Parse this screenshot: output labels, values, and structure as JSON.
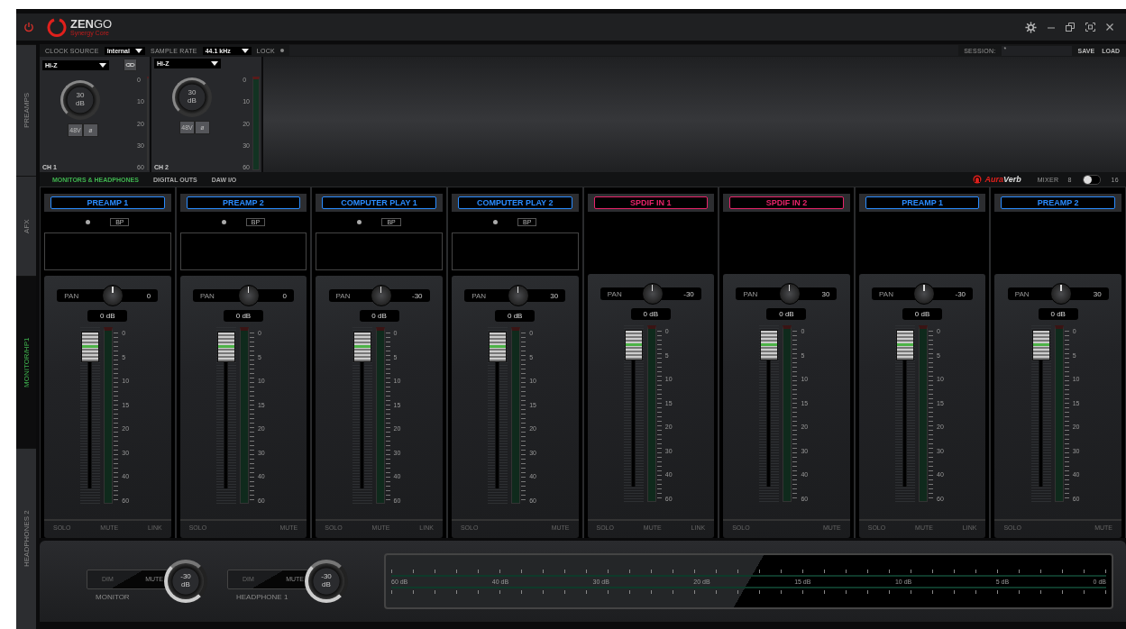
{
  "logo": {
    "name": "**ZEN**GO",
    "tagline": "Synergy Core"
  },
  "side_tabs": [
    {
      "label": "PREAMPS",
      "selected": false
    },
    {
      "label": "AFX",
      "selected": false
    },
    {
      "label": "MONITOR/HP1",
      "selected": true
    },
    {
      "label": "HEADPHONES 2",
      "selected": false
    }
  ],
  "preamp_toolbar": {
    "clock_source_label": "CLOCK SOURCE",
    "clock_source": "Internal",
    "sample_rate_label": "SAMPLE RATE",
    "sample_rate": "44.1 kHz",
    "lock_label": "LOCK",
    "locked": false,
    "session_label": "SESSION:",
    "session_value": "*",
    "buttons": [
      "SAVE",
      "LOAD"
    ]
  },
  "preamps": [
    {
      "input": "Hi-Z",
      "linkable": true,
      "gain_value": "30",
      "gain_unit": "dB",
      "phantom": "48V",
      "phase": "ø",
      "name": "CH 1",
      "scale": [
        "0",
        "10",
        "20",
        "30",
        "60"
      ]
    },
    {
      "input": "Hi-Z",
      "linkable": false,
      "gain_value": "30",
      "gain_unit": "dB",
      "phantom": "48V",
      "phase": "ø",
      "name": "CH 2",
      "scale": [
        "0",
        "10",
        "20",
        "30",
        "60"
      ]
    }
  ],
  "tabs": [
    {
      "label": "MONITORS & HEADPHONES",
      "selected": true
    },
    {
      "label": "DIGITAL OUTS",
      "selected": false
    },
    {
      "label": "DAW I/O",
      "selected": false
    }
  ],
  "brand": "**Aura**Verb",
  "mixer": {
    "label": "MIXER",
    "low_label": "8",
    "high_label": "16",
    "on": false
  },
  "channels": [
    {
      "kind": "preamp",
      "name": "PREAMP 1",
      "color": "#2a8cff",
      "bypass": "BP",
      "pan_label": "PAN",
      "pan": "0",
      "volume": "0 dB",
      "fader": {
        "level": 0.97
      },
      "scale": [
        "0",
        "5",
        "10",
        "15",
        "20",
        "30",
        "40",
        "60"
      ],
      "buttons": [
        {
          "label": "SOLO",
          "on": false
        },
        {
          "label": "MUTE",
          "on": false
        },
        {
          "label": "LINK",
          "on": false
        }
      ]
    },
    {
      "kind": "preamp",
      "name": "PREAMP 2",
      "color": "#2a8cff",
      "bypass": "BP",
      "pan_label": "PAN",
      "pan": "0",
      "volume": "0 dB",
      "fader": {
        "level": 0.97
      },
      "scale": [
        "0",
        "5",
        "10",
        "15",
        "20",
        "30",
        "40",
        "60"
      ],
      "buttons": [
        {
          "label": "SOLO",
          "on": false
        },
        {
          "label": "MUTE",
          "on": false
        }
      ]
    },
    {
      "kind": "preamp",
      "name": "COMPUTER PLAY 1",
      "color": "#2a8cff",
      "bypass": "BP",
      "pan_label": "PAN",
      "pan": "-30",
      "volume": "0 dB",
      "fader": {
        "level": 0.97
      },
      "scale": [
        "0",
        "5",
        "10",
        "15",
        "20",
        "30",
        "40",
        "60"
      ],
      "buttons": [
        {
          "label": "SOLO",
          "on": false
        },
        {
          "label": "MUTE",
          "on": false
        },
        {
          "label": "LINK",
          "on": false
        }
      ]
    },
    {
      "kind": "preamp",
      "name": "COMPUTER PLAY 2",
      "color": "#2a8cff",
      "bypass": "BP",
      "pan_label": "PAN",
      "pan": "30",
      "volume": "0 dB",
      "fader": {
        "level": 0.97
      },
      "scale": [
        "0",
        "5",
        "10",
        "15",
        "20",
        "30",
        "40",
        "60"
      ],
      "buttons": [
        {
          "label": "SOLO",
          "on": false
        },
        {
          "label": "MUTE",
          "on": false
        }
      ]
    },
    {
      "kind": "digital",
      "name": "SPDIF IN 1",
      "color": "#e8246a",
      "pan_label": "PAN",
      "pan": "-30",
      "volume": "0 dB",
      "fader": {
        "level": 0.97
      },
      "scale": [
        "0",
        "5",
        "10",
        "15",
        "20",
        "30",
        "40",
        "60"
      ],
      "buttons": [
        {
          "label": "SOLO",
          "on": false
        },
        {
          "label": "MUTE",
          "on": false
        },
        {
          "label": "LINK",
          "on": false
        }
      ]
    },
    {
      "kind": "digital",
      "name": "SPDIF IN 2",
      "color": "#e8246a",
      "pan_label": "PAN",
      "pan": "30",
      "volume": "0 dB",
      "fader": {
        "level": 0.97
      },
      "scale": [
        "0",
        "5",
        "10",
        "15",
        "20",
        "30",
        "40",
        "60"
      ],
      "buttons": [
        {
          "label": "SOLO",
          "on": false
        },
        {
          "label": "MUTE",
          "on": false
        }
      ]
    },
    {
      "kind": "digital",
      "name": "PREAMP 1",
      "color": "#2a8cff",
      "pan_label": "PAN",
      "pan": "-30",
      "volume": "0 dB",
      "fader": {
        "level": 0.97
      },
      "scale": [
        "0",
        "5",
        "10",
        "15",
        "20",
        "30",
        "40",
        "60"
      ],
      "buttons": [
        {
          "label": "SOLO",
          "on": false
        },
        {
          "label": "MUTE",
          "on": false
        },
        {
          "label": "LINK",
          "on": false
        }
      ]
    },
    {
      "kind": "digital",
      "name": "PREAMP 2",
      "color": "#2a8cff",
      "pan_label": "PAN",
      "pan": "30",
      "volume": "0 dB",
      "fader": {
        "level": 0.97
      },
      "scale": [
        "0",
        "5",
        "10",
        "15",
        "20",
        "30",
        "40",
        "60"
      ],
      "buttons": [
        {
          "label": "SOLO",
          "on": false
        },
        {
          "label": "MUTE",
          "on": false
        }
      ]
    }
  ],
  "outputs": [
    {
      "dim": "DIM",
      "mute": "MUTE",
      "name": "MONITOR",
      "level_value": "-30",
      "level_unit": "dB"
    },
    {
      "dim": "DIM",
      "mute": "MUTE",
      "name": "HEADPHONE 1",
      "level_value": "-30",
      "level_unit": "dB"
    }
  ],
  "output_meter": {
    "scale": [
      "60 dB",
      "40 dB",
      "30 dB",
      "20 dB",
      "15 dB",
      "10 dB",
      "5 dB",
      "0 dB"
    ]
  }
}
